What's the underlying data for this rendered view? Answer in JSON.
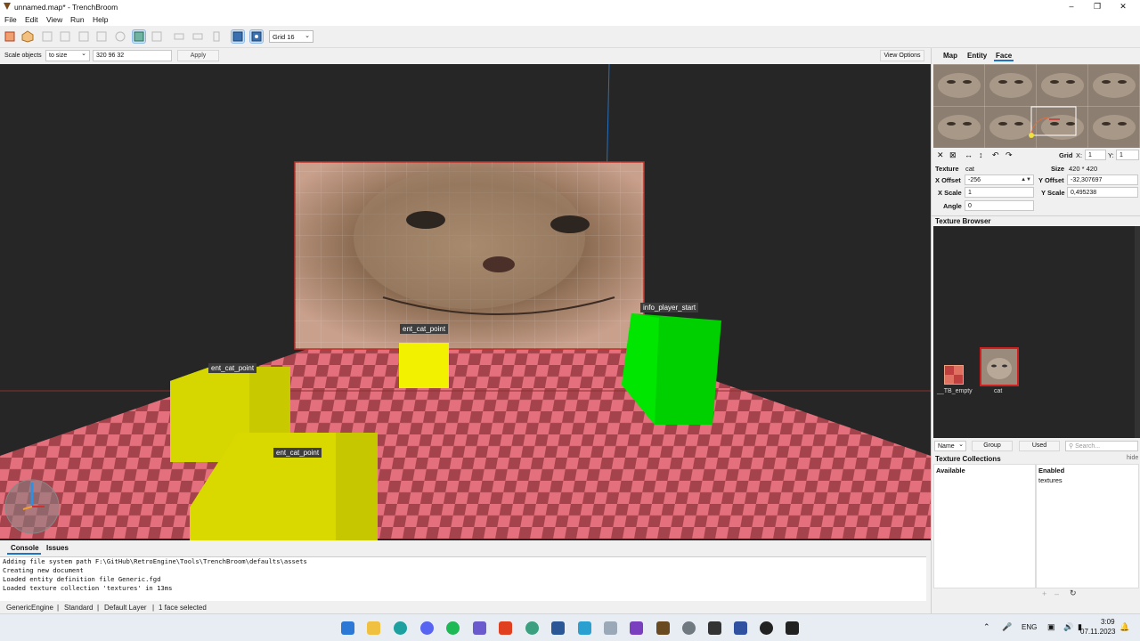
{
  "window": {
    "title": "unnamed.map* - TrenchBroom"
  },
  "menu": {
    "items": [
      "File",
      "Edit",
      "View",
      "Run",
      "Help"
    ]
  },
  "toolbar": {
    "grid_value": "Grid 16"
  },
  "scalebar": {
    "label": "Scale objects",
    "mode": "to size",
    "size_value": "320 96 32",
    "apply_label": "Apply",
    "view_options_label": "View Options"
  },
  "viewport": {
    "labels": [
      "ent_cat_point",
      "ent_cat_point",
      "ent_cat_point",
      "info_player_start"
    ]
  },
  "bottom": {
    "tabs": [
      "Console",
      "Issues"
    ],
    "console_lines": [
      "Adding file system path F:\\GitHub\\RetroEngine\\Tools\\TrenchBroom\\defaults\\assets",
      "Creating new document",
      "Loaded entity definition file Generic.fgd",
      "Loaded texture collection 'textures' in 13ms"
    ]
  },
  "status": {
    "engine": "GenericEngine",
    "mode": "Standard",
    "layer": "Default Layer",
    "selection": "1 face selected"
  },
  "inspector": {
    "tabs": [
      "Map",
      "Entity",
      "Face"
    ],
    "active_tab": "Face",
    "grid_label": "Grid",
    "grid_x_label": "X:",
    "grid_x": "1",
    "grid_y_label": "Y:",
    "grid_y": "1",
    "texture_label": "Texture",
    "texture_name": "cat",
    "size_label": "Size",
    "size_value": "420 * 420",
    "x_offset_label": "X Offset",
    "x_offset": "-256",
    "y_offset_label": "Y Offset",
    "y_offset": "-32,307697",
    "x_scale_label": "X Scale",
    "x_scale": "1",
    "y_scale_label": "Y Scale",
    "y_scale": "0,495238",
    "angle_label": "Angle",
    "angle": "0"
  },
  "texture_browser": {
    "title": "Texture Browser",
    "textures": [
      "__TB_empty",
      "cat"
    ],
    "sort_label": "Name",
    "group_label": "Group",
    "used_label": "Used",
    "search_placeholder": "Search..."
  },
  "texture_collections": {
    "title": "Texture Collections",
    "hide_label": "hide",
    "available_label": "Available",
    "enabled_label": "Enabled",
    "enabled_items": [
      "textures"
    ]
  },
  "taskbar": {
    "lang": "ENG",
    "time": "3:09",
    "date": "07.11.2023"
  },
  "colors": {
    "accent": "#1e73c8",
    "brush_yellow": "#e8e800",
    "player_green": "#00e600",
    "floor_pink": "#e3707c",
    "floor_dark": "#a5434c"
  }
}
